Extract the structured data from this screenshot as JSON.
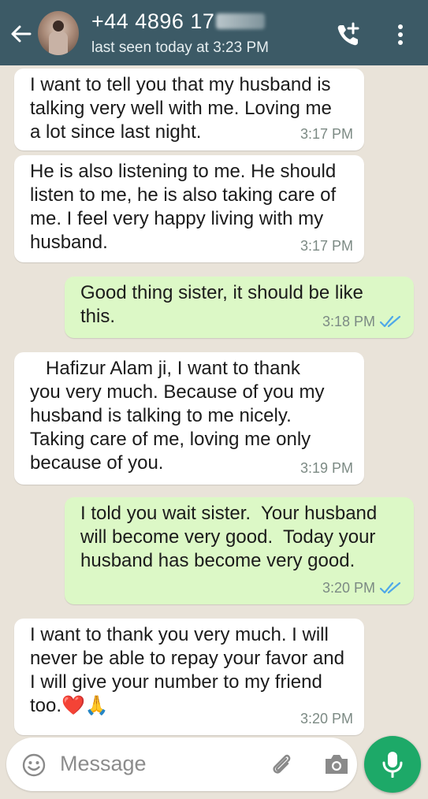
{
  "header": {
    "contact_name": "+44 4896 17",
    "last_seen": "last seen today at 3:23 PM"
  },
  "messages": [
    {
      "direction": "incoming",
      "text": "I want to tell you that my husband is\ntalking very well with me. Loving me\na lot since last night.",
      "time": "3:17 PM"
    },
    {
      "direction": "incoming",
      "text": "He is also listening to me. He should\nlisten to me, he is also taking care of\nme. I feel very happy living with my\nhusband.",
      "time": "3:17 PM"
    },
    {
      "direction": "outgoing",
      "text": "Good thing sister, it should be like\nthis.",
      "time": "3:18 PM",
      "status": "read"
    },
    {
      "direction": "incoming",
      "text": "   Hafizur Alam ji, I want to thank\nyou very much. Because of you my\nhusband is talking to me nicely.\nTaking care of me, loving me only\nbecause of you.",
      "time": "3:19 PM"
    },
    {
      "direction": "outgoing",
      "text": "I told you wait sister.  Your husband\nwill become very good.  Today your\nhusband has become very good.",
      "time": "3:20 PM",
      "status": "read"
    },
    {
      "direction": "incoming",
      "text": "I want to thank you very much. I will\nnever be able to repay your favor and\nI will give your number to my friend\ntoo.❤️🙏",
      "time": "3:20 PM"
    }
  ],
  "composer": {
    "placeholder": "Message"
  },
  "icons": {
    "back": "back-arrow-icon",
    "call": "add-call-icon",
    "menu": "more-vertical-icon",
    "emoji": "emoji-icon",
    "attach": "paperclip-icon",
    "camera": "camera-icon",
    "mic": "microphone-icon"
  },
  "colors": {
    "header": "#3c5a66",
    "outgoing_bubble": "#dcf8c6",
    "incoming_bubble": "#ffffff",
    "read_ticks": "#4fa8e8",
    "mic_button": "#1da968"
  }
}
